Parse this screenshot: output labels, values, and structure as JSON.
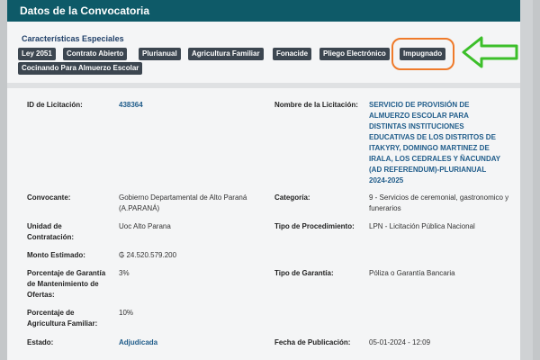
{
  "header": {
    "title": "Datos de la Convocatoria"
  },
  "characteristics": {
    "title": "Características Especiales",
    "tags": [
      "Ley 2051",
      "Contrato Abierto",
      "Plurianual",
      "Agricultura Familiar",
      "Fonacide",
      "Pliego Electrónico",
      "Impugnado",
      "Cocinando Para Almuerzo Escolar"
    ],
    "highlighted_tag": "Impugnado",
    "highlight_color": "#ef7a2a",
    "arrow_color": "#3cbf2a"
  },
  "details": {
    "id_label": "ID de Licitación:",
    "id_value": "438364",
    "name_label": "Nombre de la Licitación:",
    "name_value": "SERVICIO DE PROVISIÓN DE ALMUERZO ESCOLAR PARA DISTINTAS INSTITUCIONES EDUCATIVAS DE LOS DISTRITOS DE ITAKYRY, DOMINGO MARTINEZ DE IRALA, LOS CEDRALES Y ÑACUNDAY (AD REFERENDUM)-PLURIANUAL 2024-2025",
    "convocante_label": "Convocante:",
    "convocante_value": "Gobierno Departamental de Alto Paraná (A.PARANÁ)",
    "categoria_label": "Categoría:",
    "categoria_value": "9 - Servicios de ceremonial, gastronomico y funerarios",
    "unidad_label": "Unidad de Contratación:",
    "unidad_value": "Uoc Alto Parana",
    "procedimiento_label": "Tipo de Procedimiento:",
    "procedimiento_value": "LPN - Licitación Pública Nacional",
    "monto_label": "Monto Estimado:",
    "monto_value": "₲ 24.520.579.200",
    "garantia_pct_label": "Porcentaje de Garantía de Mantenimiento de Ofertas:",
    "garantia_pct_value": "3%",
    "garantia_tipo_label": "Tipo de Garantía:",
    "garantia_tipo_value": "Póliza o Garantía Bancaria",
    "agri_label": "Porcentaje de Agricultura Familiar:",
    "agri_value": "10%",
    "estado_label": "Estado:",
    "estado_value": "Adjudicada",
    "fecha_label": "Fecha de Publicación:",
    "fecha_value": "05-01-2024 - 12:09"
  }
}
